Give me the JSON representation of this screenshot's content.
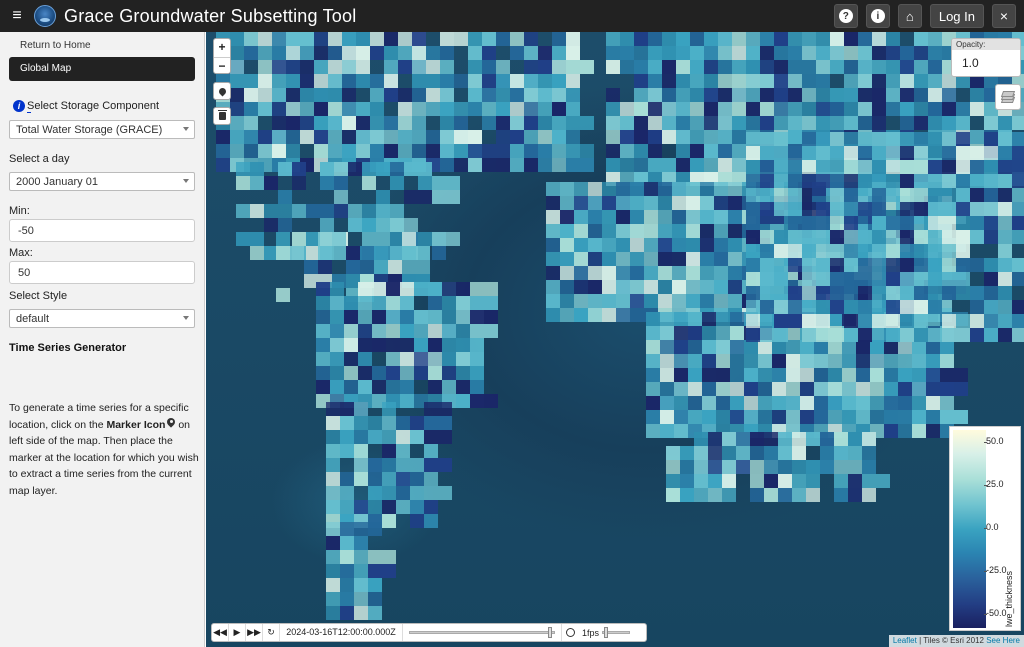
{
  "header": {
    "title": "Grace Groundwater Subsetting Tool",
    "menu_icon": "hamburger-icon",
    "help_icon": "question-icon",
    "info_icon": "info-icon",
    "home_icon": "home-icon",
    "login_label": "Log In",
    "close_label": "×",
    "help_glyph": "?",
    "info_glyph": "i",
    "home_glyph": "⌂"
  },
  "sidebar": {
    "return_link": "Return to Home",
    "global_map": "Global Map",
    "info_glyph": "i",
    "storage_label": "Select Storage Component",
    "storage_value": "Total Water Storage (GRACE)",
    "day_label": "Select a day",
    "day_value": "2000 January 01",
    "min_label": "Min:",
    "min_value": "-50",
    "max_label": "Max:",
    "max_value": "50",
    "style_label": "Select Style",
    "style_value": "default",
    "ts_heading": "Time Series Generator",
    "ts_text_1": "To generate a time series for a specific location, click on the ",
    "ts_text_bold": "Marker Icon",
    "ts_text_2": " on left side of the map. Then place the marker at the location for which you wish to extract a time series from the current map layer."
  },
  "map": {
    "zoom_in": "+",
    "zoom_out": "−",
    "opacity_label": "Opacity:",
    "opacity_value": "1.0",
    "legend": {
      "ticks": [
        "50.0",
        "25.0",
        "0.0",
        "-25.0",
        "-50.0"
      ],
      "axis_label": "lwe_thickness",
      "colors": [
        "#fffbdd",
        "#a9dfd8",
        "#3aa3c1",
        "#2a619c",
        "#1a2060"
      ]
    },
    "timebar": {
      "back": "◀◀",
      "play": "▶",
      "forward": "▶▶",
      "loop": "↻",
      "date": "2024-03-16T12:00:00.000Z",
      "fps": "1fps",
      "position": 0.98
    },
    "attribution": {
      "leaflet": "Leaflet",
      "tiles": " | Tiles © Esri 2012 ",
      "see_here": "See Here"
    }
  }
}
